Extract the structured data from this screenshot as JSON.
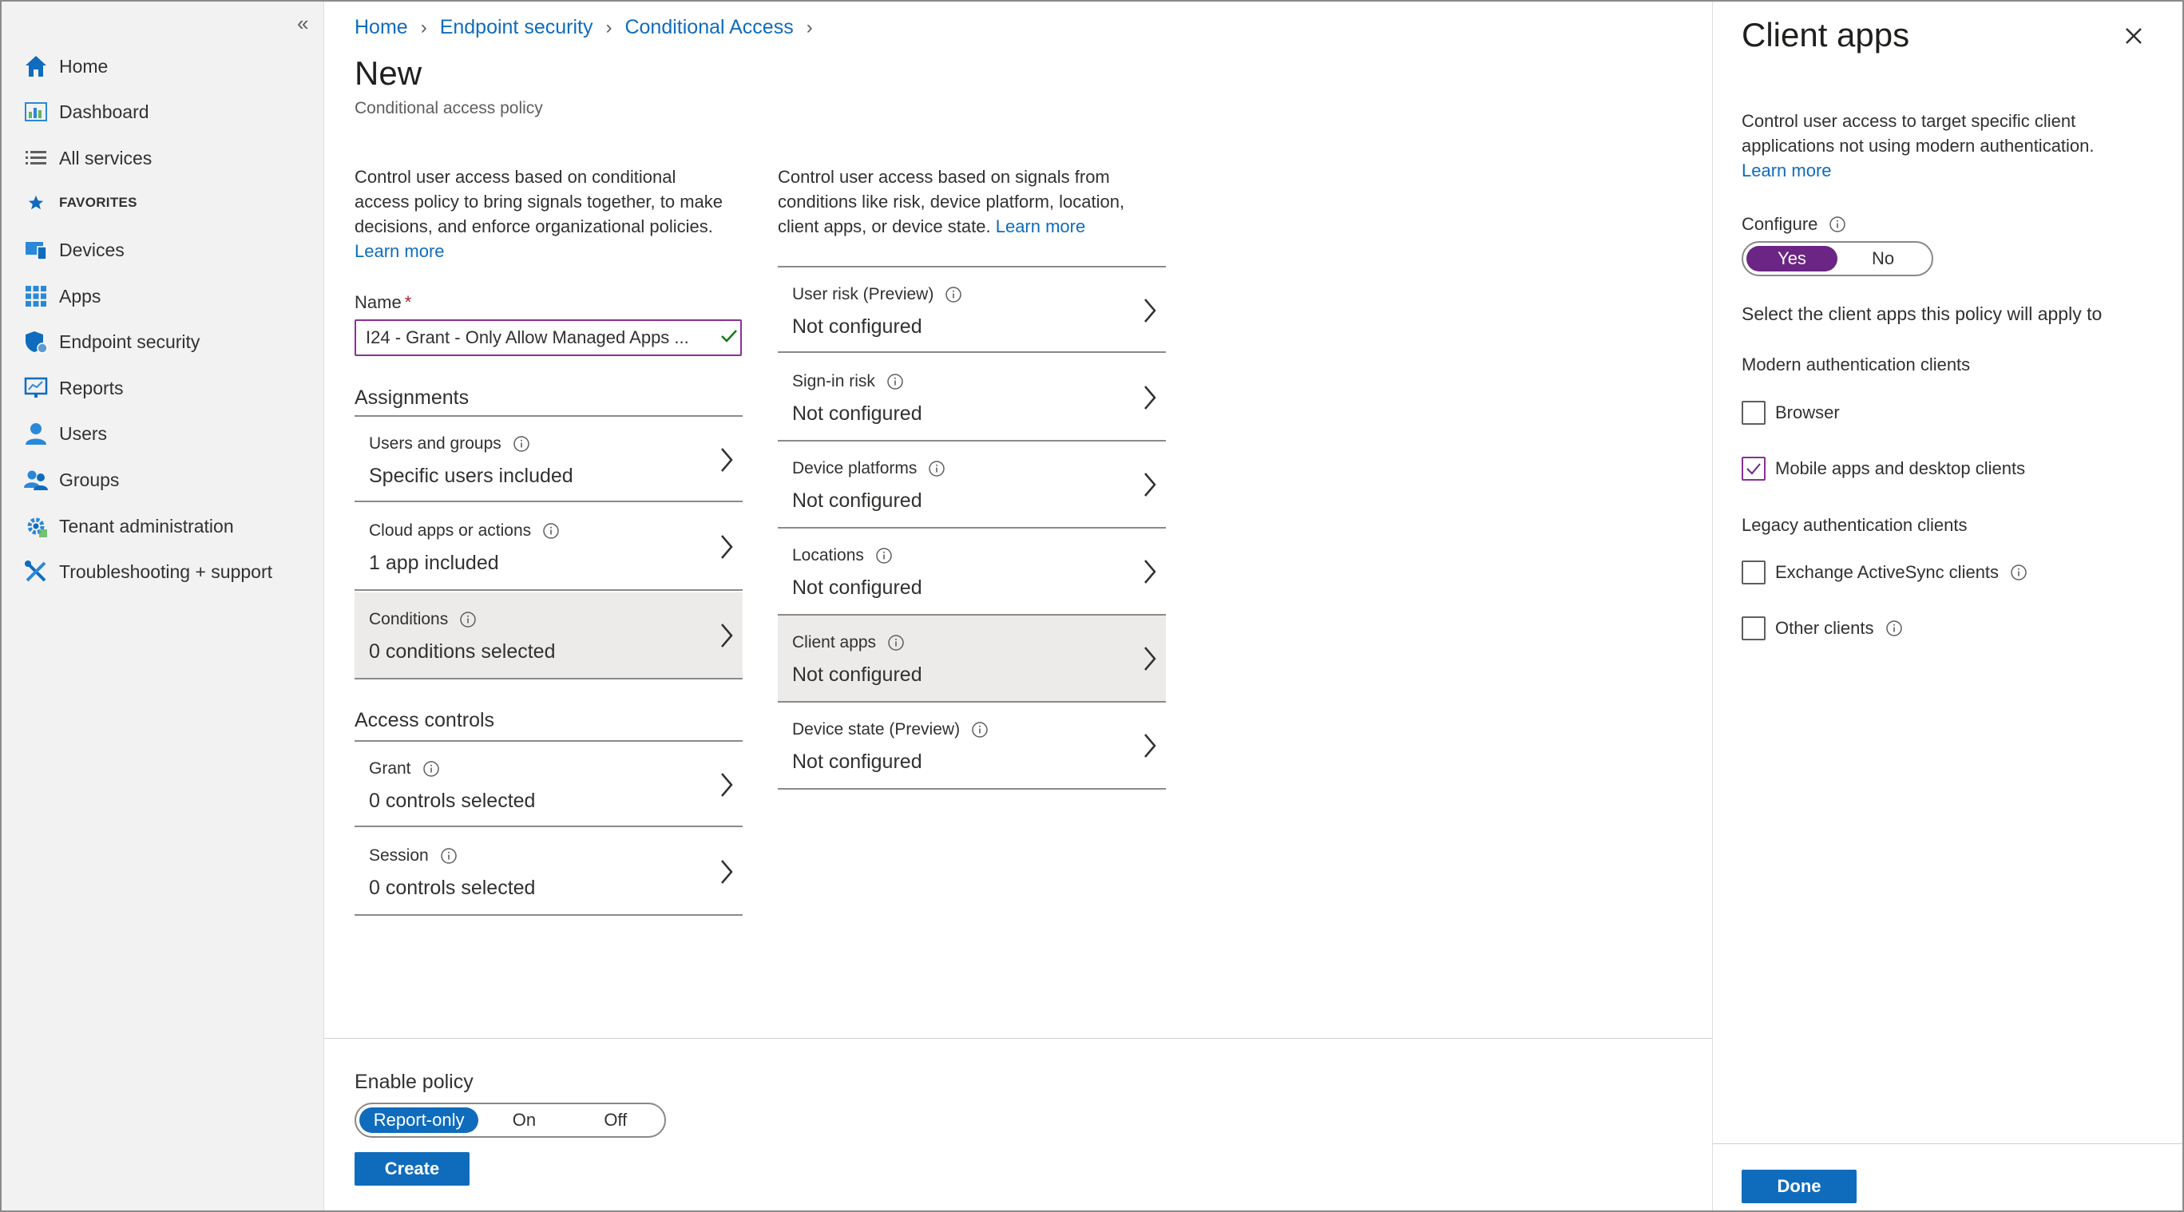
{
  "sidebar": {
    "collapse_glyph": "«",
    "items": [
      {
        "label": "Home",
        "icon": "home-icon"
      },
      {
        "label": "Dashboard",
        "icon": "dashboard-icon"
      },
      {
        "label": "All services",
        "icon": "list-icon"
      },
      {
        "label": "FAVORITES",
        "icon": "star-icon"
      },
      {
        "label": "Devices",
        "icon": "devices-icon"
      },
      {
        "label": "Apps",
        "icon": "apps-grid-icon"
      },
      {
        "label": "Endpoint security",
        "icon": "shield-icon"
      },
      {
        "label": "Reports",
        "icon": "reports-icon"
      },
      {
        "label": "Users",
        "icon": "user-icon"
      },
      {
        "label": "Groups",
        "icon": "groups-icon"
      },
      {
        "label": "Tenant administration",
        "icon": "tenant-admin-icon"
      },
      {
        "label": "Troubleshooting + support",
        "icon": "tools-icon"
      }
    ]
  },
  "breadcrumb": [
    "Home",
    "Endpoint security",
    "Conditional Access"
  ],
  "page": {
    "title": "New",
    "subtitle": "Conditional access policy",
    "intro_left": "Control user access based on conditional access policy to bring signals together, to make decisions, and enforce organizational policies.",
    "intro_right": "Control user access based on signals from conditions like risk, device platform, location, client apps, or device state.",
    "learn_more": "Learn more"
  },
  "name_field": {
    "label": "Name",
    "required_mark": "*",
    "value": "I24 - Grant - Only Allow Managed Apps ..."
  },
  "assignments": {
    "title": "Assignments",
    "rows": [
      {
        "label": "Users and groups",
        "value": "Specific users included"
      },
      {
        "label": "Cloud apps or actions",
        "value": "1 app included"
      },
      {
        "label": "Conditions",
        "value": "0 conditions selected"
      }
    ]
  },
  "access_controls": {
    "title": "Access controls",
    "rows": [
      {
        "label": "Grant",
        "value": "0 controls selected"
      },
      {
        "label": "Session",
        "value": "0 controls selected"
      }
    ]
  },
  "conditions": {
    "rows": [
      {
        "label": "User risk (Preview)",
        "value": "Not configured"
      },
      {
        "label": "Sign-in risk",
        "value": "Not configured"
      },
      {
        "label": "Device platforms",
        "value": "Not configured"
      },
      {
        "label": "Locations",
        "value": "Not configured"
      },
      {
        "label": "Client apps",
        "value": "Not configured"
      },
      {
        "label": "Device state (Preview)",
        "value": "Not configured"
      }
    ]
  },
  "footer": {
    "enable_label": "Enable policy",
    "options": [
      "Report-only",
      "On",
      "Off"
    ],
    "selected": "Report-only",
    "create_label": "Create"
  },
  "panel": {
    "title": "Client apps",
    "description": "Control user access to target specific client applications not using modern authentication.",
    "learn_more": "Learn more",
    "configure_label": "Configure",
    "configure_options": [
      "Yes",
      "No"
    ],
    "configure_selected": "Yes",
    "select_text": "Select the client apps this policy will apply to",
    "modern_title": "Modern authentication clients",
    "modern": [
      {
        "label": "Browser",
        "checked": false
      },
      {
        "label": "Mobile apps and desktop clients",
        "checked": true
      }
    ],
    "legacy_title": "Legacy authentication clients",
    "legacy": [
      {
        "label": "Exchange ActiveSync clients",
        "checked": false
      },
      {
        "label": "Other clients",
        "checked": false
      }
    ],
    "done_label": "Done"
  },
  "colors": {
    "accent_blue": "#0f6cbd",
    "accent_purple": "#6b2584",
    "selected_row": "#edebe9"
  }
}
